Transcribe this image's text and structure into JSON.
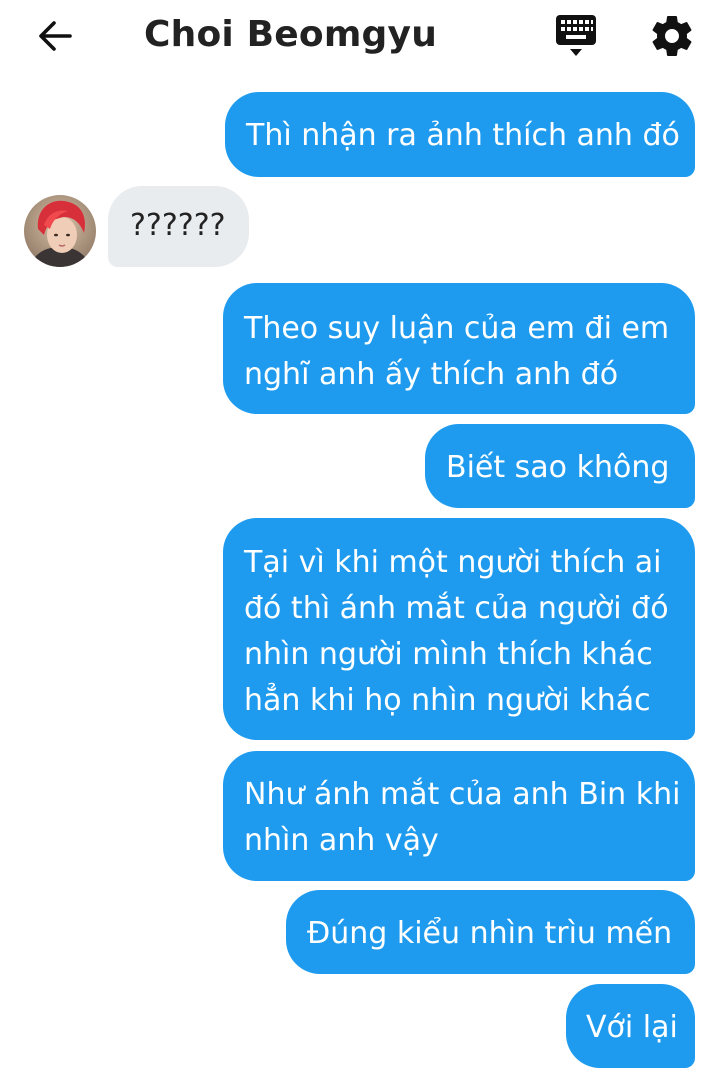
{
  "header": {
    "contact_name": "Choi Beomgyu",
    "icons": {
      "back": "arrow-left-icon",
      "keyboard": "keyboard-icon",
      "settings": "gear-icon"
    }
  },
  "colors": {
    "outgoing_bubble": "#1e9bef",
    "incoming_bubble": "#e8ecef",
    "outgoing_text": "#ffffff",
    "incoming_text": "#222222"
  },
  "messages": [
    {
      "from": "me",
      "lines": [
        "Thì nhận ra ảnh thích anh đó"
      ]
    },
    {
      "from": "them",
      "lines": [
        "??????"
      ]
    },
    {
      "from": "me",
      "lines": [
        "Theo suy luận của em đi em",
        "nghĩ anh ấy thích anh đó"
      ]
    },
    {
      "from": "me",
      "lines": [
        "Biết sao không"
      ]
    },
    {
      "from": "me",
      "lines": [
        "Tại vì khi một người thích ai",
        "đó thì ánh mắt của người đó",
        "nhìn người mình thích khác",
        "hẳn khi họ nhìn người khác"
      ]
    },
    {
      "from": "me",
      "lines": [
        "Như ánh mắt của anh Bin khi",
        "nhìn anh vậy"
      ]
    },
    {
      "from": "me",
      "lines": [
        "Đúng kiểu nhìn trìu mến"
      ]
    },
    {
      "from": "me",
      "lines": [
        "Với lại"
      ]
    }
  ]
}
